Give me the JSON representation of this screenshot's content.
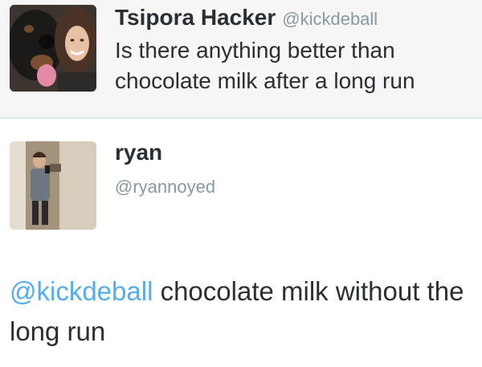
{
  "tweets": [
    {
      "display_name": "Tsipora Hacker",
      "handle": "@kickdeball",
      "text": "Is there anything better than chocolate milk after a long run"
    },
    {
      "display_name": "ryan",
      "handle": "@ryannoyed",
      "mention": "@kickdeball",
      "text": " chocolate milk without the long run"
    }
  ],
  "colors": {
    "text": "#292f33",
    "handle": "#8899a6",
    "mention": "#55acee",
    "divider": "#e1e8ed"
  }
}
